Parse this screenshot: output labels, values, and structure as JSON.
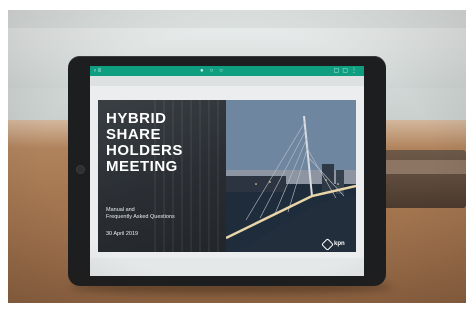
{
  "cover": {
    "title_line1": "HYBRID",
    "title_line2": "SHARE",
    "title_line3": "HOLDERS",
    "title_line4": "MEETING",
    "subtitle_line1": "Manual and",
    "subtitle_line2": "Frequently Asked Questions",
    "date": "30 April 2019",
    "logo_text": "kpn"
  },
  "colors": {
    "topbar_accent": "#0f9f80",
    "cover_dark": "#2a2e33",
    "tablet_bezel": "#1d1e20"
  },
  "icons": {
    "toolbar_left": "back-icon",
    "toolbar_center": "page-nav-icons",
    "toolbar_right": "share-icon",
    "logo": "kpn-logo-icon"
  }
}
